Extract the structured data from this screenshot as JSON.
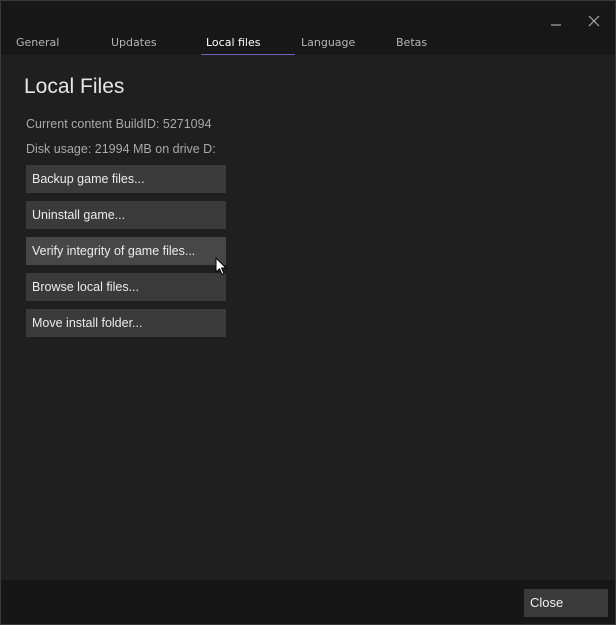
{
  "window": {
    "minimize_icon": "minimize-icon",
    "close_icon": "close-icon"
  },
  "tabs": [
    {
      "label": "General",
      "active": false
    },
    {
      "label": "Updates",
      "active": false
    },
    {
      "label": "Local files",
      "active": true
    },
    {
      "label": "Language",
      "active": false
    },
    {
      "label": "Betas",
      "active": false
    }
  ],
  "main": {
    "title": "Local Files",
    "build_info": "Current content BuildID: 5271094",
    "disk_usage": "Disk usage: 21994 MB on drive D:",
    "buttons": [
      {
        "label": "Backup game files..."
      },
      {
        "label": "Uninstall game..."
      },
      {
        "label": "Verify integrity of game files...",
        "hovered": true
      },
      {
        "label": "Browse local files..."
      },
      {
        "label": "Move install folder..."
      }
    ]
  },
  "footer": {
    "close_label": "Close"
  },
  "colors": {
    "accent": "#7b5cc4",
    "background": "#1f1f1f",
    "button": "#3a3a3a"
  }
}
